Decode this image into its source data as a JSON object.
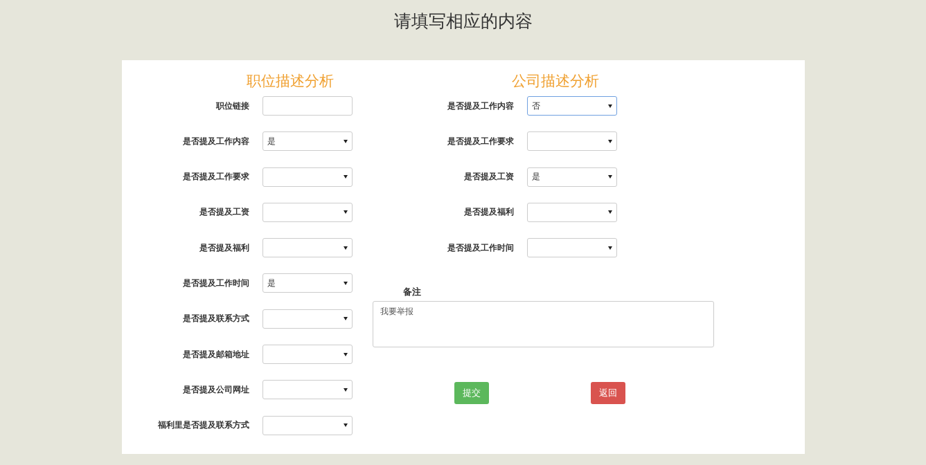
{
  "title": "请填写相应的内容",
  "job_section": {
    "heading": "职位描述分析",
    "fields": [
      {
        "kind": "text",
        "label": "职位链接"
      },
      {
        "kind": "select",
        "label": "是否提及工作内容",
        "value": "是",
        "focused": false
      },
      {
        "kind": "select",
        "label": "是否提及工作要求",
        "focused": false
      },
      {
        "kind": "select",
        "label": "是否提及工资",
        "focused": false
      },
      {
        "kind": "select",
        "label": "是否提及福利",
        "focused": false
      },
      {
        "kind": "select",
        "label": "是否提及工作时间",
        "value": "是",
        "focused": false
      },
      {
        "kind": "select",
        "label": "是否提及联系方式",
        "focused": false
      },
      {
        "kind": "select",
        "label": "是否提及邮箱地址",
        "focused": false
      },
      {
        "kind": "select",
        "label": "是否提及公司网址",
        "focused": false
      },
      {
        "kind": "select",
        "label": "福利里是否提及联系方式",
        "focused": false
      }
    ]
  },
  "company_section": {
    "heading": "公司描述分析",
    "fields": [
      {
        "kind": "select",
        "label": "是否提及工作内容",
        "value": "否",
        "focused": true
      },
      {
        "kind": "select",
        "label": "是否提及工作要求",
        "focused": false
      },
      {
        "kind": "select",
        "label": "是否提及工资",
        "value": "是",
        "focused": false
      },
      {
        "kind": "select",
        "label": "是否提及福利",
        "focused": false
      },
      {
        "kind": "select",
        "label": "是否提及工作时间",
        "focused": false
      }
    ]
  },
  "note": {
    "label": "备注",
    "value": "我要举报"
  },
  "buttons": [
    {
      "kind": "submit",
      "label": "提交"
    },
    {
      "kind": "back",
      "label": "返回"
    }
  ]
}
